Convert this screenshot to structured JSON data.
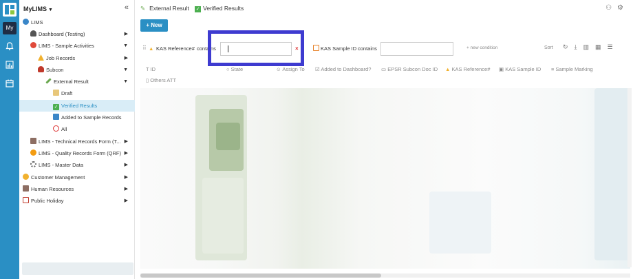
{
  "rail": {
    "my_label": "My"
  },
  "sidebar": {
    "title": "MyLIMS",
    "collapse_icon": "«",
    "items": [
      {
        "label": "LIMS",
        "icon": "globe-icon"
      },
      {
        "label": "Dashboard (Testing)",
        "icon": "person-icon"
      },
      {
        "label": "LIMS - Sample Activities",
        "icon": "spiral-icon"
      },
      {
        "label": "Job Records",
        "icon": "warning-icon"
      },
      {
        "label": "Subcon",
        "icon": "person-icon"
      },
      {
        "label": "External Result",
        "icon": "pencil-icon"
      },
      {
        "label": "Draft",
        "icon": "note-icon"
      },
      {
        "label": "Verified Results",
        "icon": "check-icon"
      },
      {
        "label": "Added to Sample Records",
        "icon": "doc-icon"
      },
      {
        "label": "All",
        "icon": "circle-icon"
      },
      {
        "label": "LIMS - Technical Records Form (T...",
        "icon": "tools-icon"
      },
      {
        "label": "LIMS - Quality Records Form (QRF)",
        "icon": "flower-icon"
      },
      {
        "label": "LIMS - Master Data",
        "icon": "gear-icon"
      },
      {
        "label": "Customer Management",
        "icon": "face-icon"
      },
      {
        "label": "Human Resources",
        "icon": "people-icon"
      },
      {
        "label": "Public Holiday",
        "icon": "calendar-icon"
      }
    ]
  },
  "breadcrumb": {
    "parent": "External Result",
    "current": "Verified Results"
  },
  "toolbar": {
    "new_label": "New"
  },
  "filter": {
    "field1": "KAS Reference#",
    "op1": "contains",
    "value1": "",
    "field2": "KAS Sample ID",
    "op2": "contains",
    "value2": "",
    "new_condition": "new condition",
    "sort_label": "Sort"
  },
  "columns": [
    "ID",
    "State",
    "Assign To",
    "Added to Dashboard?",
    "EPSR Subcon Doc ID",
    "KAS Reference#",
    "KAS Sample ID",
    "Sample Marking",
    "Others ATT"
  ],
  "colors": {
    "accent": "#2a8fc4",
    "highlight": "#3e3bd0",
    "rail_dark": "#1f2d44"
  }
}
